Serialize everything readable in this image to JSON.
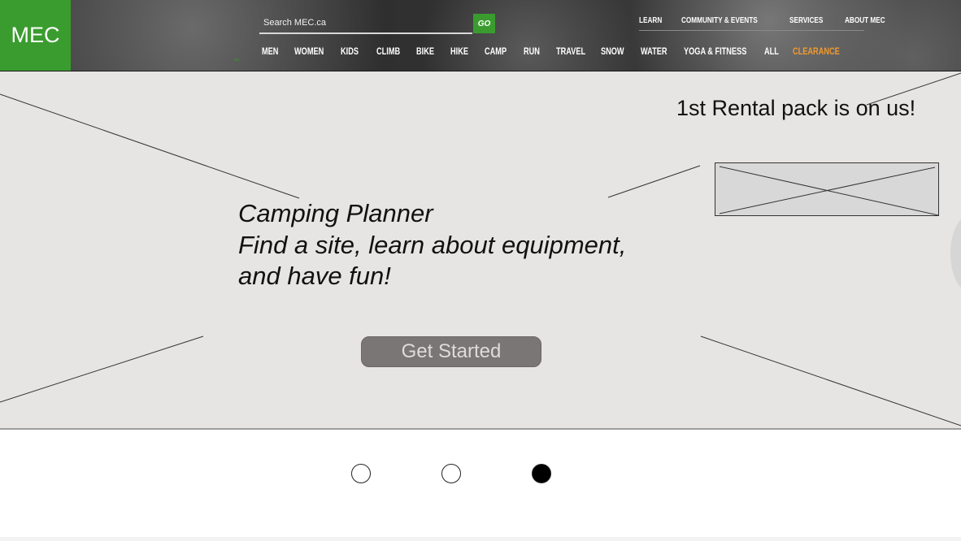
{
  "header": {
    "logo_text": "MEC",
    "search_placeholder": "Search MEC.ca",
    "go_label": "GO",
    "util_nav": [
      "LEARN",
      "COMMUNITY & EVENTS",
      "SERVICES",
      "ABOUT MEC"
    ],
    "main_nav": [
      "MEN",
      "WOMEN",
      "KIDS",
      "CLIMB",
      "BIKE",
      "HIKE",
      "CAMP",
      "RUN",
      "TRAVEL",
      "SNOW",
      "WATER",
      "YOGA & FITNESS",
      "ALL",
      "CLEARANCE"
    ],
    "colors": {
      "brand_green": "#3a9c2f",
      "clearance_orange": "#f29a2e"
    }
  },
  "hero": {
    "promo_text": "1st Rental pack is on us!",
    "headline_lines": [
      "Camping Planner",
      "Find a site, learn about equipment,",
      "and have fun!"
    ],
    "cta_label": "Get Started"
  },
  "carousel": {
    "slide_count": 3,
    "active_index": 2
  }
}
